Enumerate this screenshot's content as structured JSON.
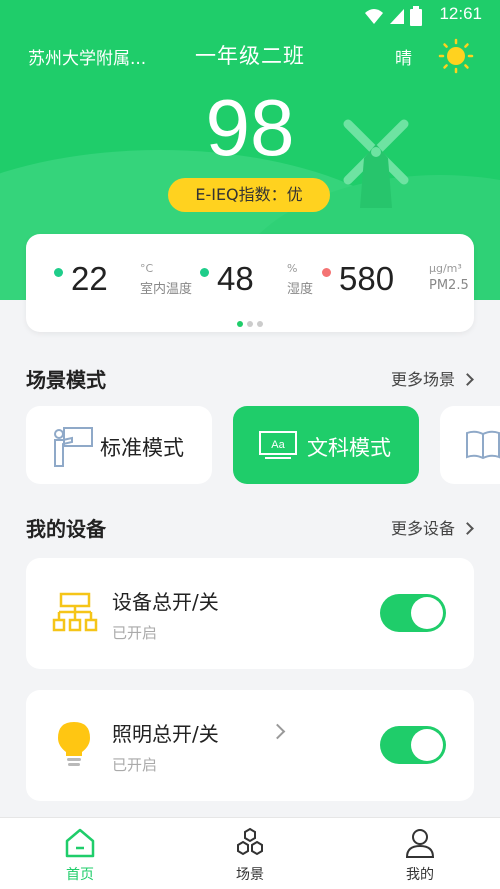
{
  "status_bar": {
    "time": "12:61"
  },
  "header": {
    "school": "苏州大学附属...",
    "class_name": "一年级二班",
    "weather": "晴",
    "score": "98",
    "index_label": "E-IEQ指数：优"
  },
  "env": {
    "items": [
      {
        "value": "22",
        "unit": "°C",
        "label": "室内温度",
        "dot_color": "#1fcd8a"
      },
      {
        "value": "48",
        "unit": "%",
        "label": "湿度",
        "dot_color": "#1fcd8a"
      },
      {
        "value": "580",
        "unit": "μg/m³",
        "label": "PM2.5",
        "dot_color": "#f47373"
      }
    ],
    "page_count": 3,
    "active_page": 1
  },
  "scenes": {
    "title": "场景模式",
    "more": "更多场景",
    "items": [
      {
        "label": "标准模式",
        "icon": "teacher-board-icon",
        "active": false
      },
      {
        "label": "文科模式",
        "icon": "projector-screen-icon",
        "active": true
      },
      {
        "label": "",
        "icon": "open-book-icon",
        "active": false
      }
    ]
  },
  "devices": {
    "title": "我的设备",
    "more": "更多设备",
    "items": [
      {
        "name": "设备总开/关",
        "status": "已开启",
        "icon": "network-hierarchy-icon",
        "on": true
      },
      {
        "name": "照明总开/关",
        "status": "已开启",
        "icon": "light-bulb-icon",
        "on": true
      }
    ]
  },
  "tabbar": {
    "items": [
      {
        "label": "首页",
        "icon": "home-icon",
        "active": true
      },
      {
        "label": "场景",
        "icon": "hexagons-icon",
        "active": false
      },
      {
        "label": "我的",
        "icon": "user-icon",
        "active": false
      }
    ]
  },
  "colors": {
    "primary": "#1fcd6a",
    "badge": "#ffd21f",
    "background": "#f3f4f6"
  }
}
